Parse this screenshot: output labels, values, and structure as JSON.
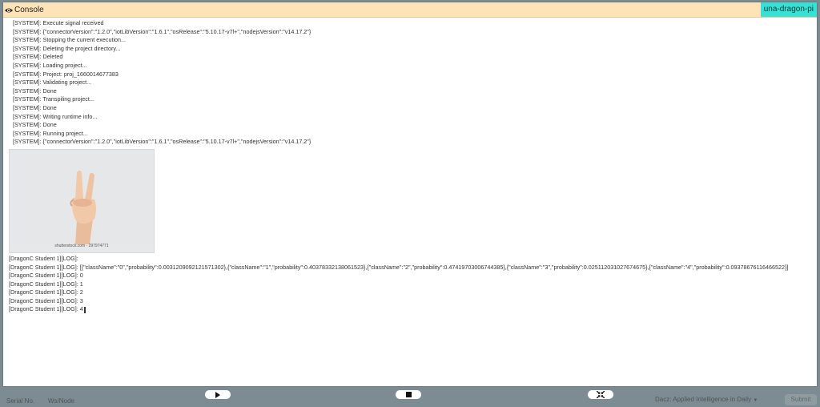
{
  "console": {
    "title": "Console",
    "device": "una-dragon-pi",
    "system_logs": [
      "[SYSTEM]: Execute signal received",
      "[SYSTEM]: {\"connectorVersion\":\"1.2.0\",\"iotLibVersion\":\"1.6.1\",\"osRelease\":\"5.10.17-v7l+\",\"nodejsVersion\":\"v14.17.2\"}",
      "[SYSTEM]: Stopping the current execution...",
      "[SYSTEM]: Deleting the project directory...",
      "[SYSTEM]: Deleted",
      "[SYSTEM]: Loading project...",
      "[SYSTEM]: Project: proj_1660014677383",
      "[SYSTEM]: Validating project...",
      "[SYSTEM]: Done",
      "[SYSTEM]: Transpiling project...",
      "[SYSTEM]: Done",
      "[SYSTEM]: Writing runtime info...",
      "[SYSTEM]: Done",
      "[SYSTEM]: Running project...",
      "[SYSTEM]: {\"connectorVersion\":\"1.2.0\",\"iotLibVersion\":\"1.6.1\",\"osRelease\":\"5.10.17-v7l+\",\"nodejsVersion\":\"v14.17.2\"}"
    ],
    "image_caption": "shutterstock.com · 297974771",
    "student_logs": [
      "[DragonC Student 1][LOG]:",
      "[DragonC Student 1][LOG]: [{\"className\":\"0\",\"probability\":0.0031209092121571302},{\"className\":\"1\",\"probability\":0.40378332138061523},{\"className\":\"2\",\"probability\":0.47419703006744385},{\"className\":\"3\",\"probability\":0.025112031027674675},{\"className\":\"4\",\"probability\":0.09378676116466522}]",
      "[DragonC Student 1][LOG]: 0",
      "[DragonC Student 1][LOG]: 1",
      "[DragonC Student 1][LOG]: 2",
      "[DragonC Student 1][LOG]: 3",
      "[DragonC Student 1][LOG]: 4"
    ]
  },
  "controls": {
    "play_icon": "play-icon",
    "stop_icon": "stop-icon",
    "collapse_icon": "collapse-arrows-icon"
  },
  "background": {
    "left_label_1": "Serial No.",
    "left_label_2": "Ws/Node",
    "select_text": "Dacz: Applied Intelligence in Daily",
    "button_text": "Submit"
  },
  "colors": {
    "header_bg": "#fde3b7",
    "device_badge_bg": "#36e2d5",
    "overlay_bg": "#7d8c92"
  }
}
